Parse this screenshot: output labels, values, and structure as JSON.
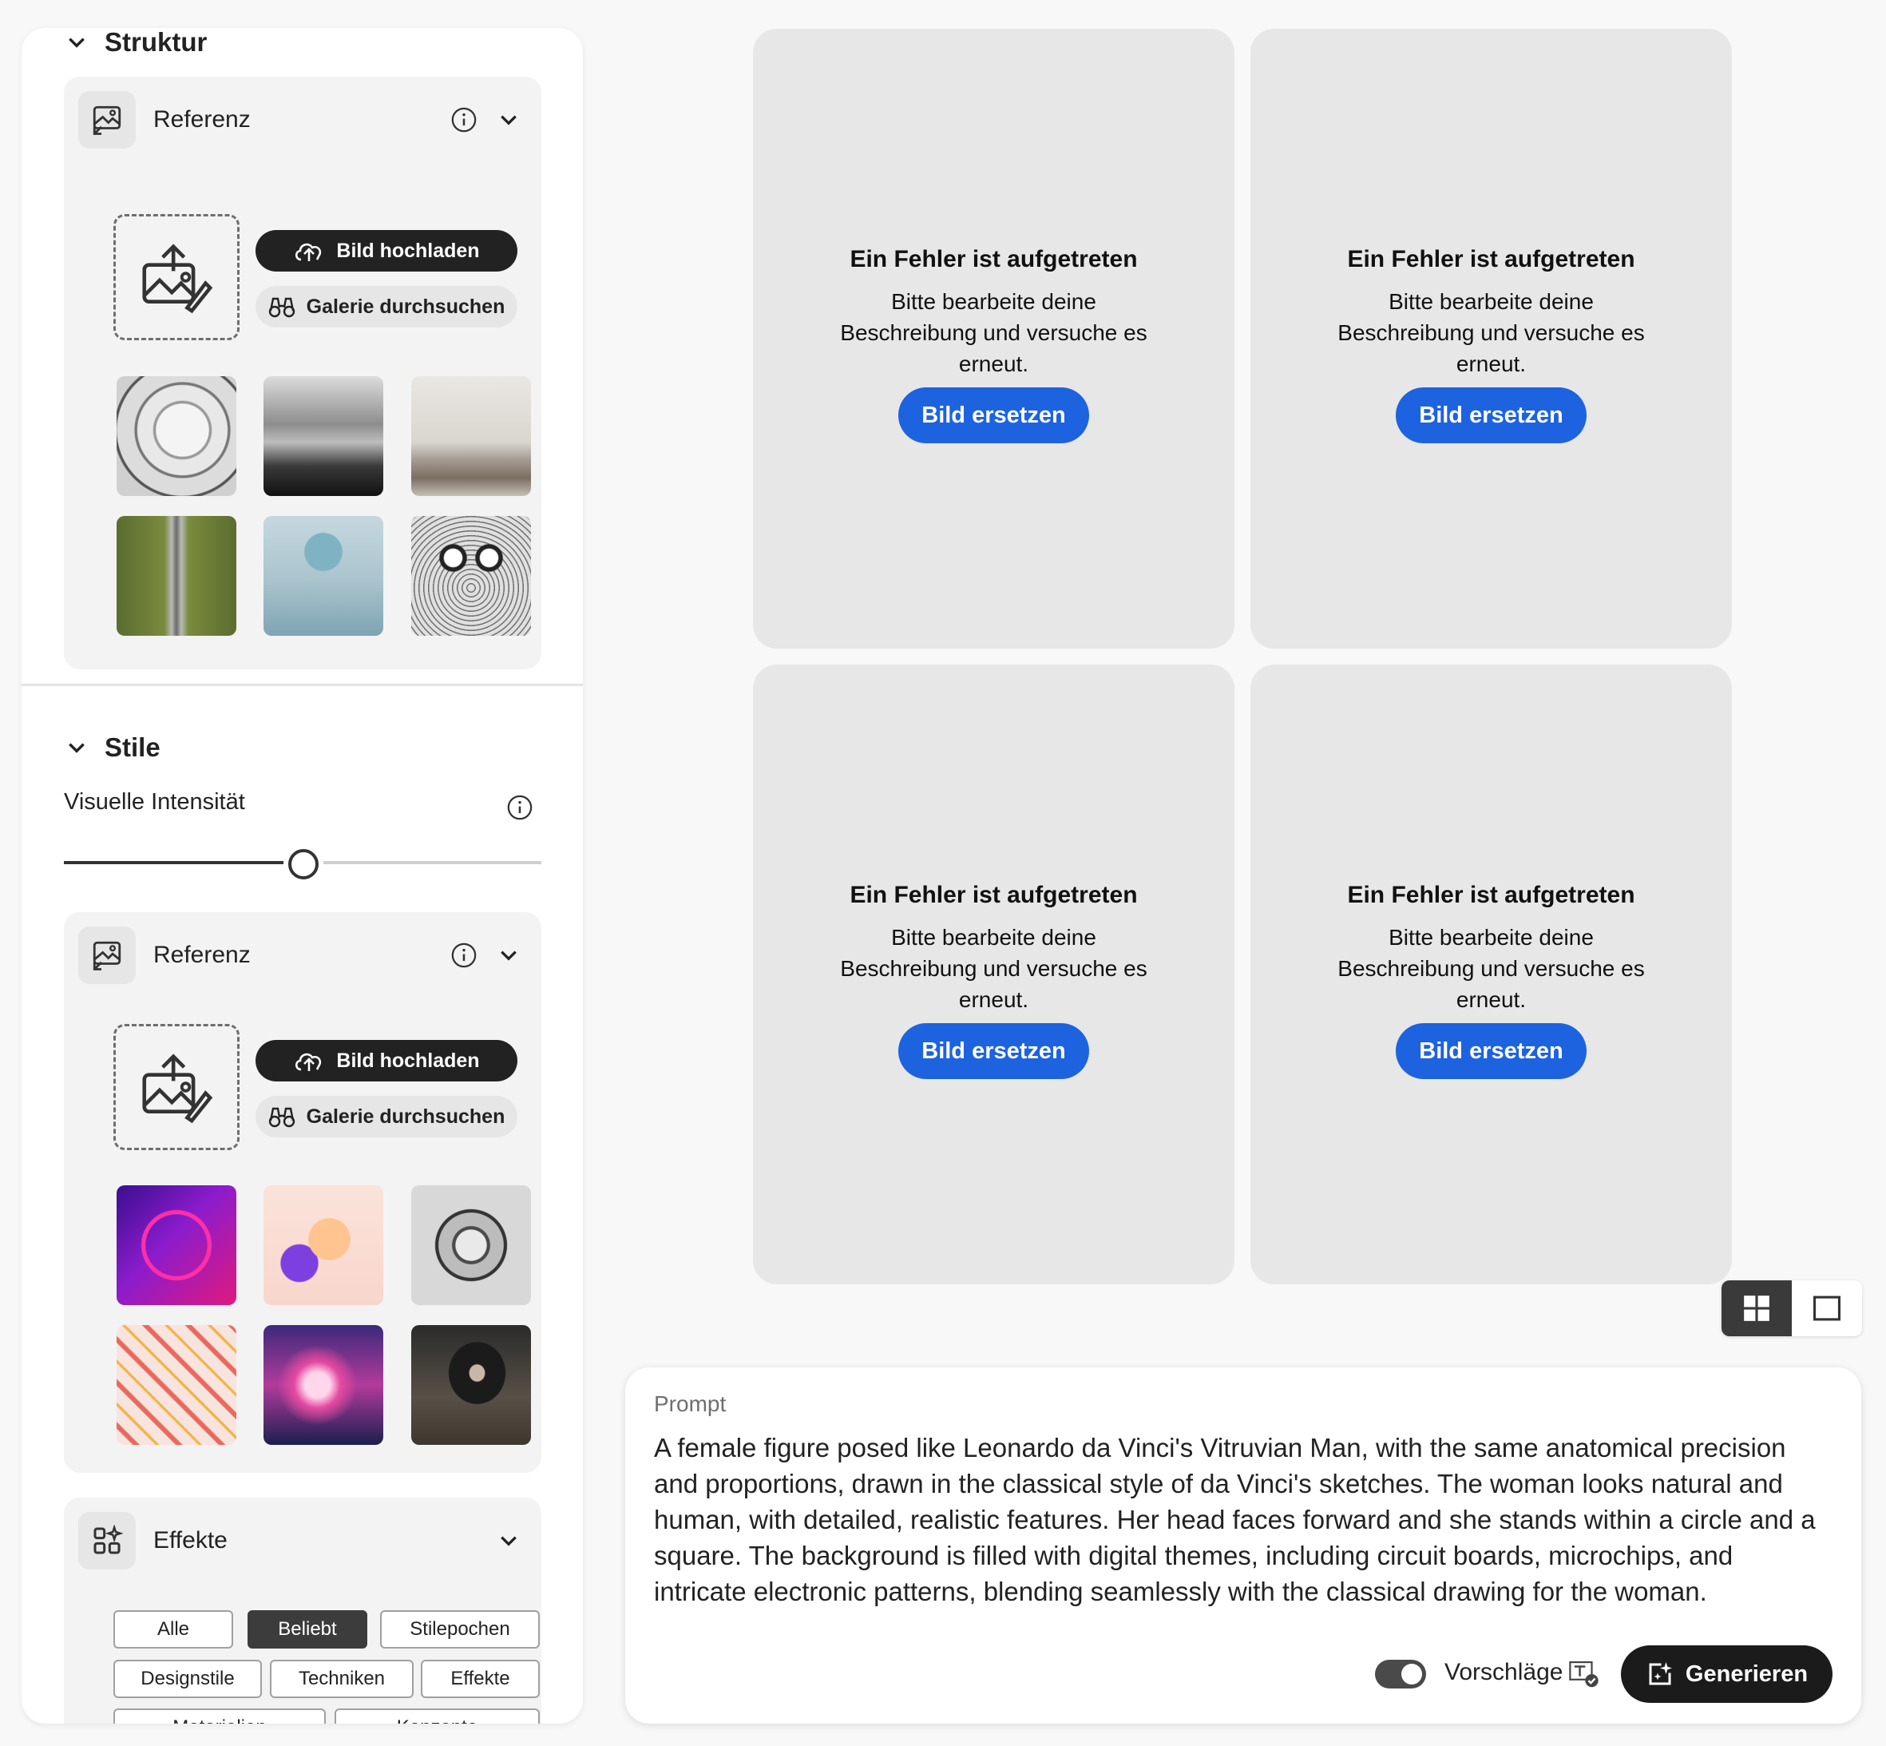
{
  "sidebar": {
    "structure": {
      "title": "Struktur",
      "reference": {
        "label": "Referenz",
        "upload_label": "Bild hochladen",
        "gallery_label": "Galerie durchsuchen",
        "thumbnails": [
          "bird-sketch",
          "misty-landscape",
          "living-room",
          "straight-road",
          "sphere-on-cube",
          "owl-sketch"
        ]
      }
    },
    "styles": {
      "title": "Stile",
      "intensity_label": "Visuelle Intensität",
      "intensity_value": 0.5,
      "reference": {
        "label": "Referenz",
        "upload_label": "Bild hochladen",
        "gallery_label": "Galerie durchsuchen",
        "thumbnails": [
          "neon-dancer",
          "3d-thumbs-up",
          "engraved-portrait",
          "hand-pattern",
          "pink-clouds",
          "seated-man"
        ]
      },
      "effects": {
        "label": "Effekte",
        "chips": [
          {
            "label": "Alle",
            "active": false
          },
          {
            "label": "Beliebt",
            "active": true
          },
          {
            "label": "Stilepochen",
            "active": false
          },
          {
            "label": "Designstile",
            "active": false
          },
          {
            "label": "Techniken",
            "active": false
          },
          {
            "label": "Effekte",
            "active": false
          },
          {
            "label": "Materialien",
            "active": false
          },
          {
            "label": "Konzepte",
            "active": false
          }
        ]
      }
    }
  },
  "results": [
    {
      "title": "Ein Fehler ist aufgetreten",
      "message": "Bitte bearbeite deine Beschreibung und versuche es erneut.",
      "button": "Bild ersetzen"
    },
    {
      "title": "Ein Fehler ist aufgetreten",
      "message": "Bitte bearbeite deine Beschreibung und versuche es erneut.",
      "button": "Bild ersetzen"
    },
    {
      "title": "Ein Fehler ist aufgetreten",
      "message": "Bitte bearbeite deine Beschreibung und versuche es erneut.",
      "button": "Bild ersetzen"
    },
    {
      "title": "Ein Fehler ist aufgetreten",
      "message": "Bitte bearbeite deine Beschreibung und versuche es erneut.",
      "button": "Bild ersetzen"
    }
  ],
  "view_toggle": {
    "selected": "grid"
  },
  "prompt": {
    "label": "Prompt",
    "text": "A female figure posed like Leonardo da Vinci's Vitruvian Man, with the same anatomical precision and proportions, drawn in the classical style of da Vinci's sketches. The woman looks natural and human, with detailed, realistic features. Her head faces forward and she stands within a circle and a square. The background is filled with digital themes, including circuit boards, microchips, and intricate electronic patterns, blending seamlessly with the classical drawing for the woman.",
    "suggestions_label": "Vorschläge",
    "suggestions_on": true,
    "generate_label": "Generieren"
  },
  "colors": {
    "accent": "#1d63e0",
    "dark": "#222222",
    "tile_bg": "#e7e7e7"
  }
}
